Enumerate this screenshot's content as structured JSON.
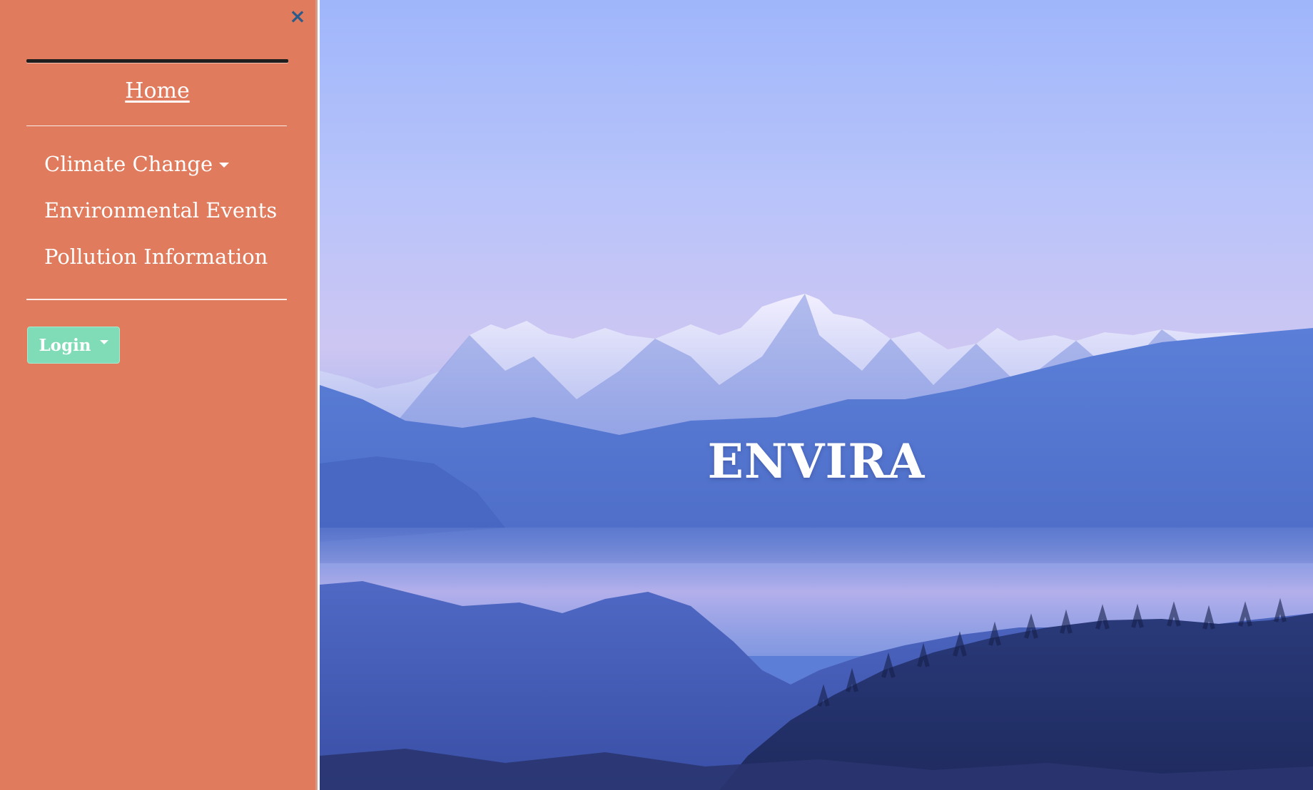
{
  "sidebar": {
    "close_icon": "×",
    "home": "Home",
    "nav_items": [
      {
        "label": "Climate Change",
        "has_dropdown": true
      },
      {
        "label": "Environmental Events",
        "has_dropdown": false
      },
      {
        "label": "Pollution Information",
        "has_dropdown": false
      }
    ],
    "login": "Login"
  },
  "hero": {
    "title": "ENVIRA"
  },
  "colors": {
    "sidebar_bg": "#e07b5d",
    "login_bg": "#7fdcb6",
    "close_icon": "#2b5b8a",
    "sky_top": "#9fb6fb"
  }
}
